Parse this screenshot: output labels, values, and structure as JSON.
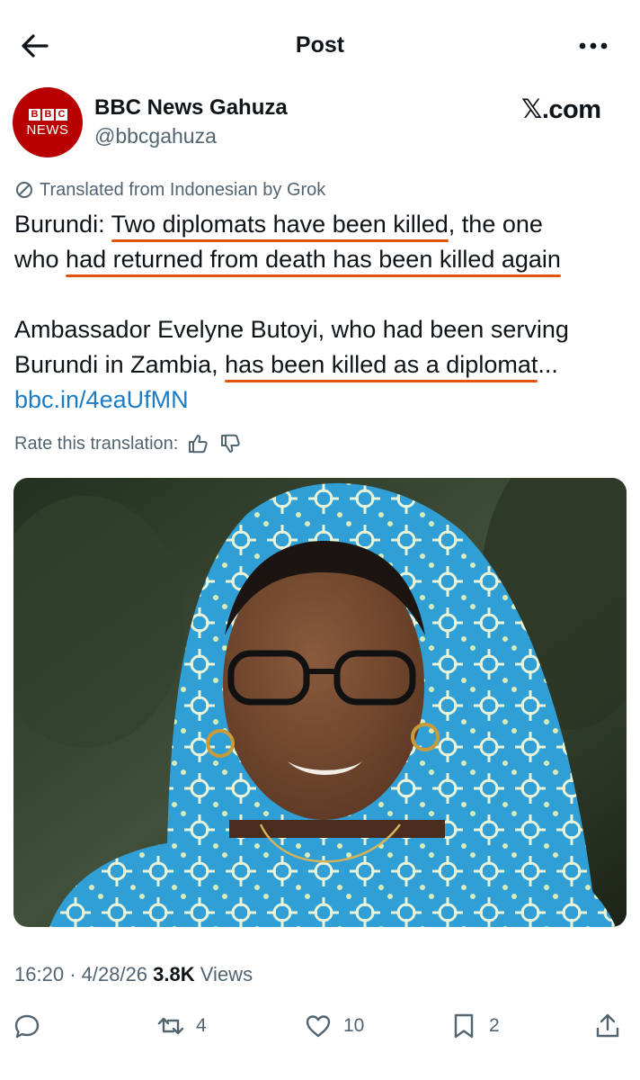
{
  "header": {
    "title": "Post"
  },
  "author": {
    "avatar_top": "BBC",
    "avatar_bottom": "NEWS",
    "display_name": "BBC News Gahuza",
    "handle": "@bbcgahuza"
  },
  "source_label": "𝕏.com",
  "translation": {
    "note": "Translated from Indonesian by Grok",
    "rate_label": "Rate this translation:"
  },
  "tweet": {
    "l1_a": "Burundi: ",
    "l1_b": "Two diplomats have been killed",
    "l1_c": ", the one",
    "l2_a": "who ",
    "l2_b": "had returned from death has been killed again",
    "l3": "Ambassador Evelyne Butoyi, who had been serving",
    "l4_a": "Burundi in Zambia, ",
    "l4_b": "has been killed as a diplomat",
    "l4_c": "...",
    "link": "bbc.in/4eaUfMN"
  },
  "meta": {
    "time": "16:20",
    "separator": "·",
    "date": "4/28/26",
    "views_count": "3.8K",
    "views_label": "Views"
  },
  "actions": {
    "replies": "",
    "reposts": "4",
    "likes": "10",
    "bookmarks": "2"
  },
  "colors": {
    "underline": "#e0540c",
    "link": "#1d7bc4",
    "avatar": "#b80000",
    "muted": "#536471",
    "scarf": "#2f9fd6"
  }
}
